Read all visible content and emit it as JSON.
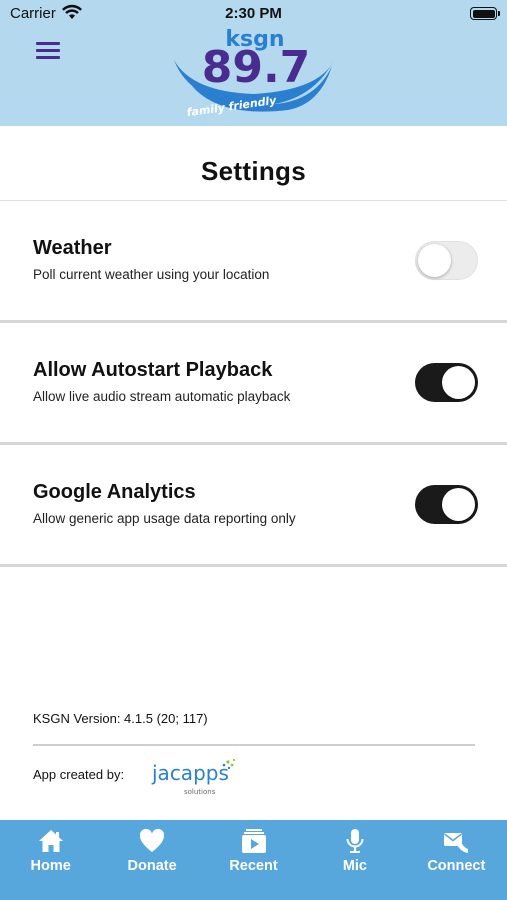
{
  "status_bar": {
    "carrier": "Carrier",
    "time": "2:30 PM"
  },
  "header": {
    "logo_text": "ksgn",
    "logo_frequency": "89.7",
    "logo_tagline": "family friendly",
    "colors": {
      "background": "#b4d9ef",
      "brand_purple": "#4a2b8f",
      "brand_blue": "#2b7fd0"
    }
  },
  "page": {
    "title": "Settings"
  },
  "settings": [
    {
      "title": "Weather",
      "description": "Poll current weather using your location",
      "enabled": false
    },
    {
      "title": "Allow Autostart Playback",
      "description": "Allow live audio stream automatic playback",
      "enabled": true
    },
    {
      "title": "Google Analytics",
      "description": "Allow generic app usage data reporting only",
      "enabled": true
    }
  ],
  "footer": {
    "version": "KSGN Version: 4.1.5 (20; 117)",
    "created_by": "App created by:",
    "vendor_name": "jacapps",
    "vendor_sub": "solutions"
  },
  "tabs": [
    {
      "label": "Home",
      "icon": "home-icon"
    },
    {
      "label": "Donate",
      "icon": "heart-icon"
    },
    {
      "label": "Recent",
      "icon": "recent-icon"
    },
    {
      "label": "Mic",
      "icon": "microphone-icon"
    },
    {
      "label": "Connect",
      "icon": "connect-icon"
    }
  ],
  "tab_bar_color": "#58a7dc"
}
